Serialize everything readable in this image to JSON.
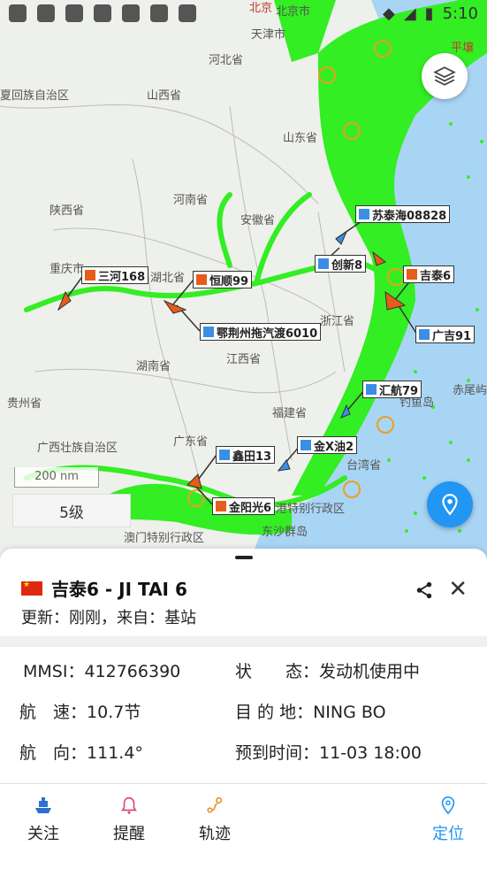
{
  "status_bar": {
    "time": "5:10"
  },
  "map_labels": {
    "beijing": "北京",
    "beijing_city": "北京市",
    "tianjin": "天津市",
    "hebei": "河北省",
    "inner_mongolia": "夏回族自治区",
    "shanxi": "山西省",
    "shandong": "山东省",
    "henan": "河南省",
    "shaanxi": "陕西省",
    "anhui": "安徽省",
    "hubei": "湖北省",
    "chongqing": "重庆市",
    "zhejiang": "浙江省",
    "jiangxi": "江西省",
    "hunan": "湖南省",
    "guizhou": "贵州省",
    "fujian": "福建省",
    "guangxi": "广西壮族自治区",
    "guangdong": "广东省",
    "taiwan": "台湾省",
    "hongkong": "港特别行政区",
    "macau": "澳门特别行政区",
    "dongsha": "东沙群岛",
    "diaoyu": "钓鱼岛",
    "chiwei": "赤尾屿",
    "pingrang": "平壤"
  },
  "ships": [
    {
      "name": "苏泰海08828",
      "color": "blue"
    },
    {
      "name": "创新8",
      "color": "blue"
    },
    {
      "name": "吉泰6",
      "color": "orange"
    },
    {
      "name": "三河168",
      "color": "orange"
    },
    {
      "name": "恒顺99",
      "color": "orange"
    },
    {
      "name": "鄂荆州拖汽渡6010",
      "color": "blue"
    },
    {
      "name": "广吉91",
      "color": "blue"
    },
    {
      "name": "汇航79",
      "color": "blue"
    },
    {
      "name": "金X油2",
      "color": "blue"
    },
    {
      "name": "鑫田13",
      "color": "blue"
    },
    {
      "name": "金阳光6",
      "color": "orange"
    }
  ],
  "scale": "200 nm",
  "zoom_level": "5级",
  "panel": {
    "title": "吉泰6 - JI TAI 6",
    "update": "更新：刚刚，来自：基站",
    "mmsi_label": "MMSI：",
    "mmsi": "412766390",
    "status_label": "状　　态：",
    "status": "发动机使用中",
    "speed_label": "航　速：",
    "speed": "10.7节",
    "dest_label": "目 的 地：",
    "dest": "NING BO",
    "course_label": "航　向：",
    "course": "111.4°",
    "eta_label": "预到时间：",
    "eta": "11-03 18:00"
  },
  "tabs": [
    {
      "label": "关注"
    },
    {
      "label": "提醒"
    },
    {
      "label": "轨迹"
    },
    {
      "label": "定位"
    }
  ],
  "colors": {
    "accent": "#2196f3",
    "track_green": "#33ee22",
    "ship_orange": "#e65c1a",
    "ship_blue": "#3a8ee6"
  }
}
